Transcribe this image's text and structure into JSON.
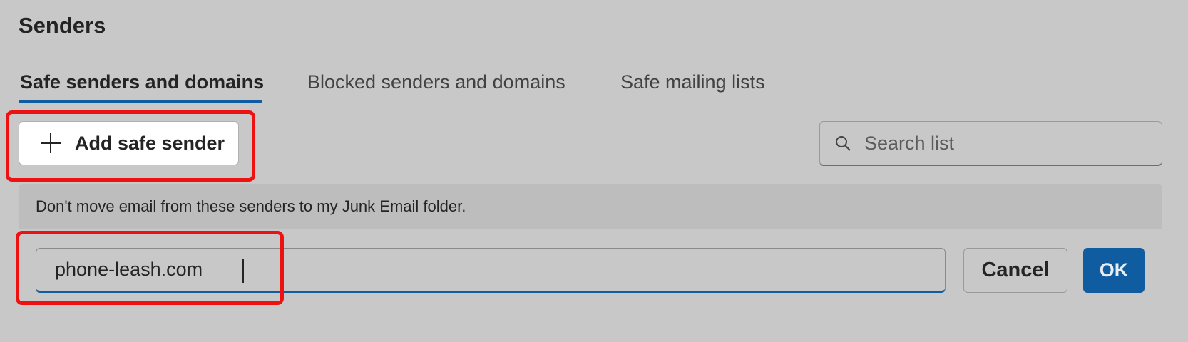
{
  "header": {
    "title": "Senders"
  },
  "tabs": [
    {
      "label": "Safe senders and domains",
      "active": true
    },
    {
      "label": "Blocked senders and domains",
      "active": false
    },
    {
      "label": "Safe mailing lists",
      "active": false
    }
  ],
  "toolbar": {
    "add_label": "Add safe sender",
    "add_icon": "plus-icon"
  },
  "search": {
    "placeholder": "Search list",
    "icon": "search-icon"
  },
  "info": {
    "text": "Don't move email from these senders to my Junk Email folder."
  },
  "editor": {
    "value": "phone-leash.com",
    "cancel_label": "Cancel",
    "ok_label": "OK"
  },
  "colors": {
    "accent": "#0f5ca0",
    "highlight": "#ee1111",
    "background": "#c8c8c8"
  }
}
